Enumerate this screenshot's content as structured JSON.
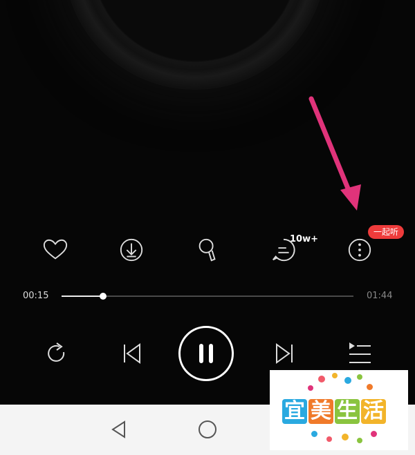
{
  "player": {
    "actions": [
      {
        "id": "like",
        "icon": "heart-icon"
      },
      {
        "id": "download",
        "icon": "download-icon"
      },
      {
        "id": "sing",
        "icon": "microphone-icon"
      },
      {
        "id": "comment",
        "icon": "comment-icon",
        "count": "10w+"
      },
      {
        "id": "more",
        "icon": "more-vertical-icon",
        "badge": "一起听"
      }
    ],
    "progress": {
      "current": "00:15",
      "total": "01:44",
      "fraction": 0.143
    },
    "controls": [
      "repeat-icon",
      "previous-icon",
      "pause-icon",
      "next-icon",
      "playlist-icon"
    ]
  },
  "annotation": {
    "color": "#e0337a"
  },
  "navigation": [
    "back-icon",
    "home-icon"
  ],
  "watermark": {
    "text": [
      "宜",
      "美",
      "生",
      "活"
    ],
    "colors": [
      "#2aa9e0",
      "#f07a2a",
      "#8ac43f",
      "#f2b42a"
    ]
  },
  "colors": {
    "badge": "#ee3b3b",
    "background": "#060606",
    "navbar": "#f4f4f4"
  }
}
